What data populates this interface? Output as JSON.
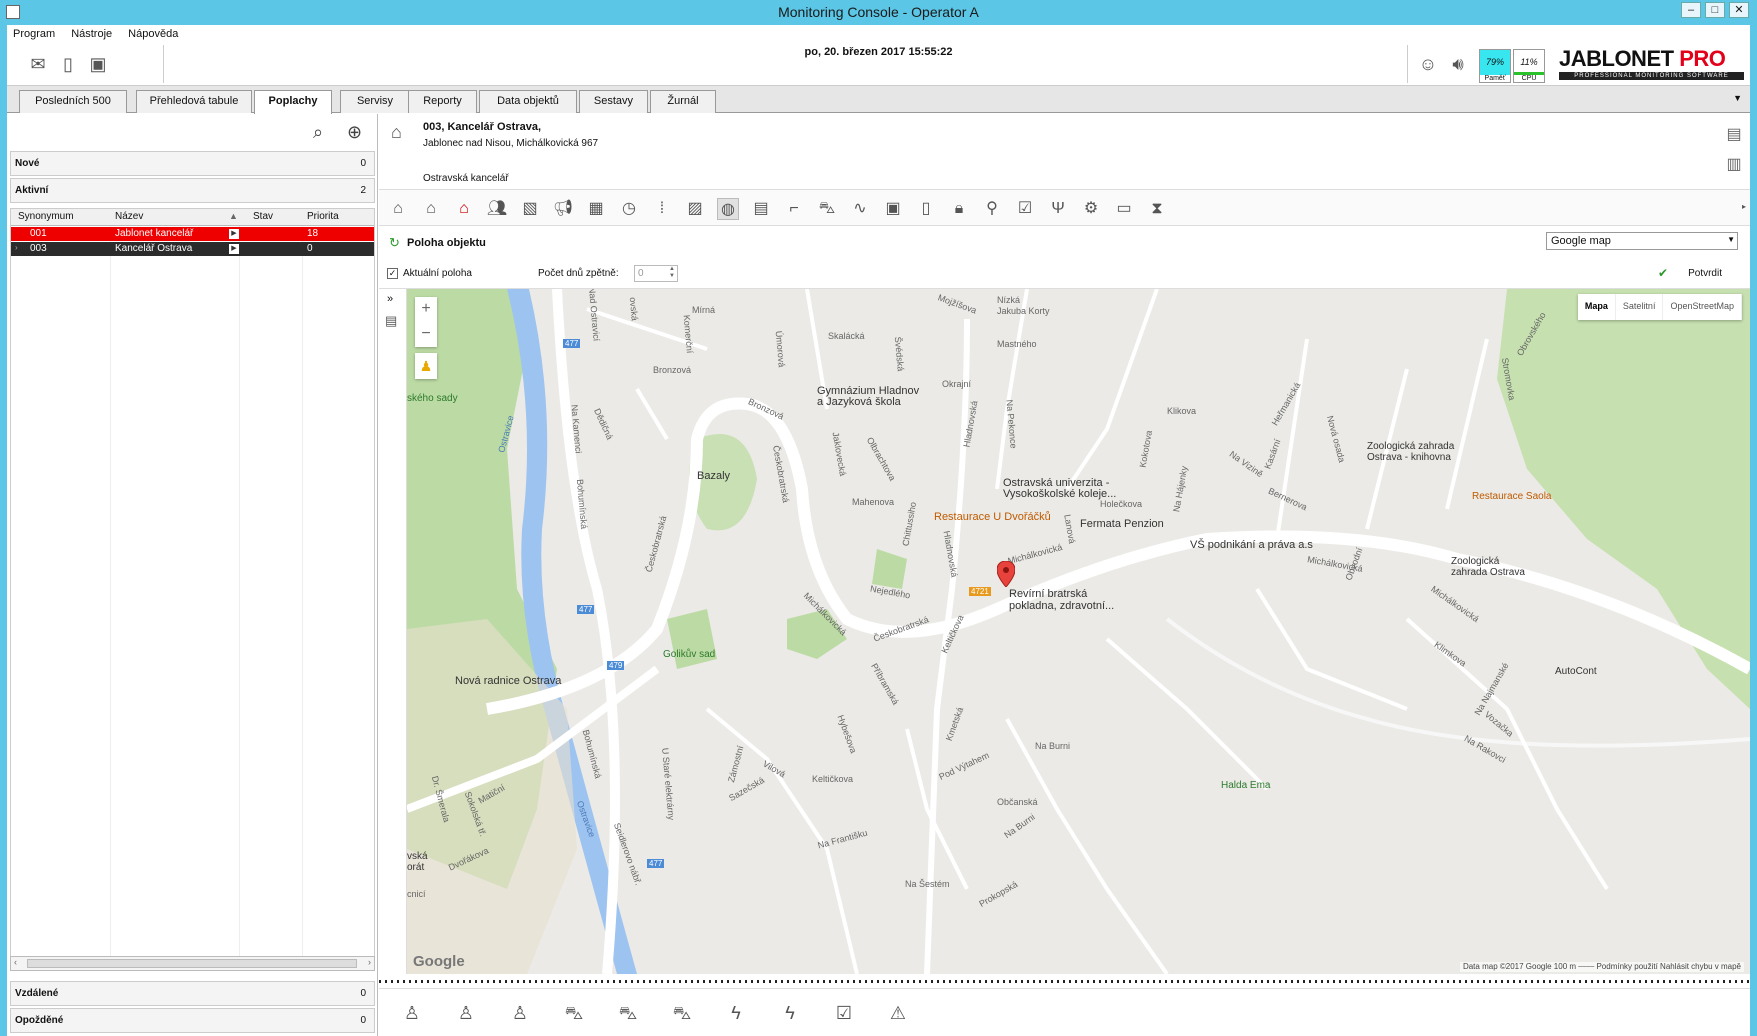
{
  "window": {
    "title": "Monitoring Console  - Operator A",
    "buttons": [
      "‒",
      "□",
      "✕"
    ]
  },
  "menu": [
    "Program",
    "Nástroje",
    "Nápověda"
  ],
  "toolbar": {
    "datetime": "po, 20. březen 2017 15:55:22",
    "memory": {
      "value": "79%",
      "label": "Paměť"
    },
    "cpu": {
      "value": "11%",
      "label": "CPU"
    },
    "logo": {
      "text": "JABLONET",
      "pro": "PRO",
      "sub": "PROFESSIONAL MONITORING SOFTWARE"
    }
  },
  "tabs": [
    {
      "label": "Posledních 500"
    },
    {
      "label": "Přehledová tabule"
    },
    {
      "label": "Poplachy",
      "active": true
    },
    {
      "label": "Servisy"
    },
    {
      "label": "Reporty"
    },
    {
      "label": "Data objektů"
    },
    {
      "label": "Sestavy"
    },
    {
      "label": "Žurnál"
    }
  ],
  "left": {
    "sections": {
      "nove": {
        "label": "Nové",
        "count": "0"
      },
      "aktivni": {
        "label": "Aktivní",
        "count": "2"
      },
      "vzdalene": {
        "label": "Vzdálené",
        "count": "0"
      },
      "opozdene": {
        "label": "Opožděné",
        "count": "0"
      }
    },
    "columns": {
      "synonym": "Synonymum",
      "name": "Název",
      "state": "Stav",
      "priority": "Priorita"
    },
    "rows": [
      {
        "synonym": "001",
        "name": "Jablonet kancelář",
        "priority": "18",
        "color": "#ee0000"
      },
      {
        "synonym": "003",
        "name": "Kancelář Ostrava",
        "priority": "0",
        "color": "#2b2b2b"
      }
    ]
  },
  "object": {
    "title": "003, Kancelář Ostrava,",
    "address": "Jablonec nad Nisou, Michálkovická 967",
    "note": "Ostravská kancelář"
  },
  "panel": {
    "title": "Poloha objektu",
    "current_position_label": "Aktuální poloha",
    "days_back_label": "Počet dnů zpětně:",
    "days_back_value": "0",
    "map_provider": "Google map",
    "confirm_label": "Potvrdit"
  },
  "map": {
    "types": [
      "Mapa",
      "Satelitní",
      "OpenStreetMap"
    ],
    "zoom_in": "+",
    "zoom_out": "−",
    "logo": "Google",
    "attribution": "Data map ©2017 Google    100 m ⎯⎯⎯⎯    Podmínky použití    Nahlásit chybu v mapě",
    "labels": {
      "gymnazium": "Gymnázium Hladnov\na Jazyková škola",
      "bazaly": "Bazaly",
      "ou": "Ostravská univerzita -\nVysokoškolské koleje...",
      "restaurace_dvorak": "Restaurace U Dvořáčků",
      "fermata": "Fermata Penzion",
      "vs": "VŠ podnikání a práva a.s",
      "zoo_lib": "Zoologická zahrada\nOstrava - knihovna",
      "restaurace_saola": "Restaurace Saola",
      "zoo": "Zoologická\nzahrada Ostrava",
      "revirni": "Revírní bratrská\npokladna, zdravotní...",
      "golikuv": "Golikův sad",
      "radnice": "Nová radnice Ostrava",
      "halda": "Halda Ema",
      "autocont": "AutoCont",
      "skeho_sady": "ského sady",
      "ostravice1": "Ostravice",
      "ostravice2": "Ostravice",
      "mirna": "Mírná",
      "skalacka": "Skalácká",
      "bronzova": "Bronzová",
      "bronzova2": "Bronzová",
      "mojzisova": "Mojžíšova",
      "nizka": "Nízká\nJakuba Korty",
      "mastneho": "Mastného",
      "okrajni": "Okrajní",
      "klikova": "Klikova",
      "hermanicka": "Heřmanická",
      "mahenova": "Mahenova",
      "holeckova": "Holečkova",
      "michalkovicka1": "Michálkovická",
      "michalkovicka2": "Michálkovická",
      "michalkovicka3": "Michálkovická",
      "michalkovicka4": "Michálkovická",
      "ceskobratrska1": "Českobratrská",
      "ceskobratrska2": "Českobratrská",
      "ceskobratrska3": "Českobratrská",
      "nejedleho": "Nejedlého",
      "keltickova": "Keltičkova",
      "keltickova2": "Keltičkova",
      "bohuminska": "Bohumínská",
      "bohuminska2": "Bohumínská",
      "dedicna": "Dědičná",
      "na_burni": "Na Burni",
      "na_burni2": "Na Burni",
      "pod_vytahem": "Pod Výtahem",
      "obcanska": "Občanská",
      "na_frantisku": "Na Františku",
      "na_sestem": "Na Šestém",
      "prokopska": "Prokopská",
      "klimkova": "Klimkova",
      "vozacka": "Vozačka",
      "na_rakovci": "Na Rakovci",
      "na_najmanske": "Na Najmanské",
      "zamostni": "Zámostní",
      "vilova": "Vilová",
      "sazecka": "Sazečská",
      "hybesova": "Hybešova",
      "pribramska": "Příbramská",
      "komercni": "Komerční",
      "dr_smerala": "Dr. Šmerala",
      "maticni": "Matiční",
      "dvorakova": "Dvořákova",
      "sokolska": "Sokolská tř.",
      "u_stare_elektrarny": "U Staré elektrárny",
      "seidlerovo": "Seidlerovo nábř.",
      "obrovskeho": "Obrovského",
      "stromovka": "Stromovka",
      "nova_osada": "Nová osada",
      "na_vizine": "Na Vizině",
      "bernerova": "Bernerova",
      "chittussiho": "Chittussiho",
      "hladnovska": "Hladnovská",
      "hladnovska2": "Hladnovská",
      "olbrachtova": "Olbrachtova",
      "jaklovecka": "Jaklovecká",
      "svedska": "Švédská",
      "na_pekonce": "Na Pekonce",
      "kokotova": "Kokotova",
      "na_hajenky": "Na Hájenky",
      "kasarni": "Kasární",
      "lanova": "Lanová",
      "obvodni": "Obvodní",
      "nad_ostravici": "Nad Ostravicí",
      "ovska": "ovská",
      "na_kamenci": "Na Kamenci",
      "umoravske": "Úmorová",
      "krnovska": "Kmetská",
      "r477a": "477",
      "r477b": "477",
      "r477c": "477",
      "r479": "479",
      "r4721": "4721",
      "vska": "vská\norát",
      "cnicka": "cnicí"
    }
  }
}
